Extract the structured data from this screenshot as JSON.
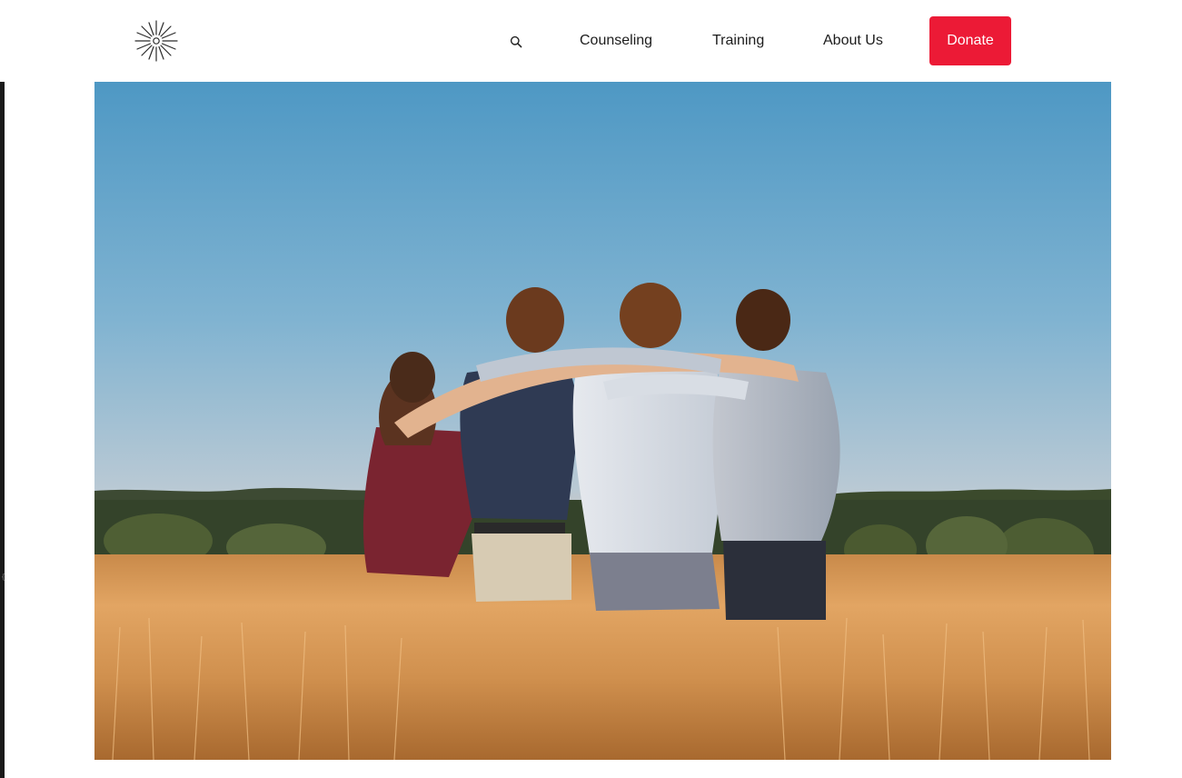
{
  "header": {
    "logo_icon": "starburst-logo-icon",
    "search_icon": "search-icon",
    "nav": {
      "counseling": "Counseling",
      "training": "Training",
      "about": "About Us"
    },
    "donate_label": "Donate"
  },
  "hero": {
    "image_subject": "four young people with arms around each other standing in a golden wheat field at sunset",
    "colors": {
      "sky_top": "#4e98c4",
      "sky_horizon": "#e8c3a4",
      "treeline": "#3b4a2c",
      "field": "#d89a55"
    }
  },
  "colors": {
    "accent": "#ec1a36",
    "text": "#1c1c1c",
    "background": "#ffffff"
  }
}
